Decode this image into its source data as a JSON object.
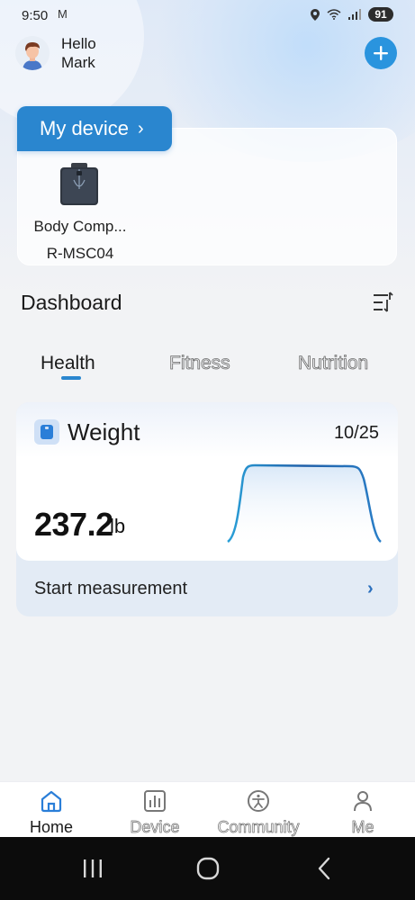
{
  "status_bar": {
    "time": "9:50",
    "mail_icon": "M",
    "battery": "91"
  },
  "header": {
    "greeting_line1": "Hello",
    "greeting_line2": "Mark"
  },
  "device_section": {
    "button_label": "My device",
    "button_chevron": "›",
    "device_name": "Body Comp...",
    "device_model": "R-MSC04"
  },
  "dashboard": {
    "title": "Dashboard",
    "tabs": [
      {
        "label": "Health",
        "active": true
      },
      {
        "label": "Fitness",
        "active": false
      },
      {
        "label": "Nutrition",
        "active": false
      }
    ]
  },
  "weight_card": {
    "title": "Weight",
    "date": "10/25",
    "value": "237.2",
    "unit": "lb",
    "action_label": "Start measurement",
    "action_chevron": "›"
  },
  "bottom_nav": [
    {
      "label": "Home",
      "icon": "home-icon",
      "active": true
    },
    {
      "label": "Device",
      "icon": "bar-chart-icon",
      "active": false
    },
    {
      "label": "Community",
      "icon": "community-icon",
      "active": false
    },
    {
      "label": "Me",
      "icon": "person-icon",
      "active": false
    }
  ],
  "colors": {
    "accent": "#2a86cf",
    "add_button": "#2a94de",
    "chart_line": "#1f6fb5"
  }
}
